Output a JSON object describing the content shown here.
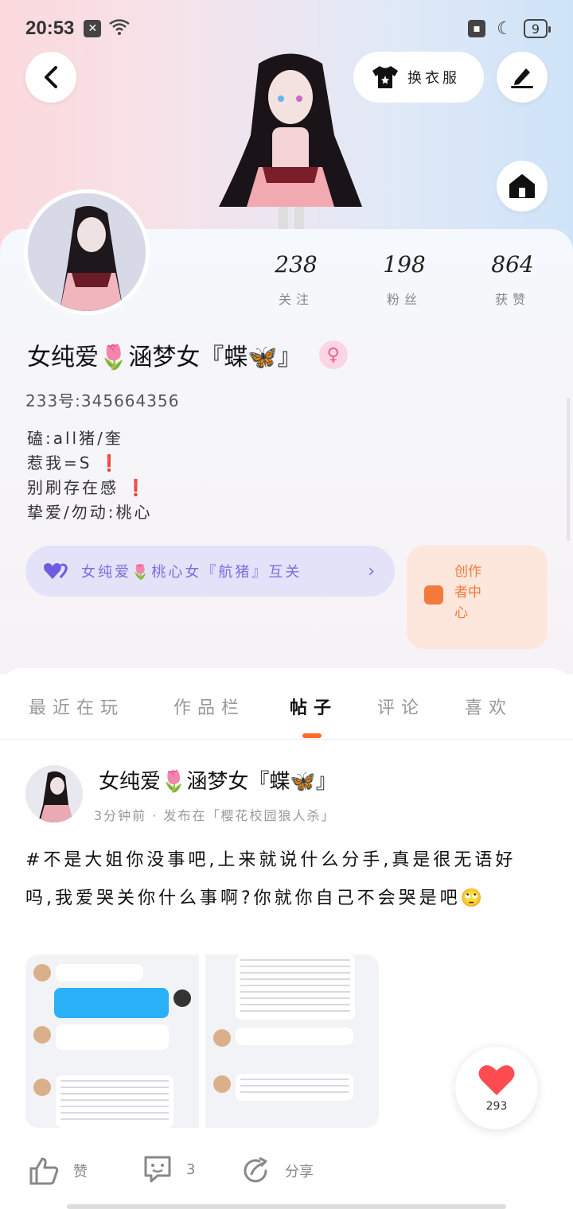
{
  "status_bar": {
    "time": "20:53",
    "battery": "9"
  },
  "header": {
    "dress_label": "换衣服"
  },
  "stats": [
    {
      "value": "238",
      "label": "关注"
    },
    {
      "value": "198",
      "label": "粉丝"
    },
    {
      "value": "864",
      "label": "获赞"
    }
  ],
  "profile": {
    "nickname": "女纯爱🌷涵梦女『蝶🦋』",
    "gender_symbol": "♀",
    "uid": "233号:345664356",
    "bio": [
      "磕:all猪/奎",
      "惹我=S",
      "别刷存在感",
      "挚爱/勿动:桃心"
    ],
    "bio_marks": [
      "❗",
      "❗"
    ]
  },
  "friend_bar": {
    "text": "女纯爱🌷桃心女『航猪』互关"
  },
  "create_card": {
    "title": "创作",
    "subtitle": "者中",
    "suffix": "心"
  },
  "tabs": [
    {
      "label": "最近在玩"
    },
    {
      "label": "作品栏"
    },
    {
      "label": "帖子"
    },
    {
      "label": "评论"
    },
    {
      "label": "喜欢"
    }
  ],
  "post": {
    "author": "女纯爱🌷涵梦女『蝶🦋』",
    "meta": "3分钟前 · 发布在「樱花校园狼人杀」",
    "text": "#不是大姐你没事吧,上来就说什么分手,真是很无语好吗,我爱哭关你什么事啊?你就你自己不会哭是吧🙄",
    "like_count": "293"
  },
  "actions": {
    "like_label": "赞",
    "comment_count": "3",
    "share_label": "分享"
  },
  "colors": {
    "accent": "#ff6a2a",
    "friend_purple": "#7a6de0",
    "create_orange": "#f27a3a"
  }
}
